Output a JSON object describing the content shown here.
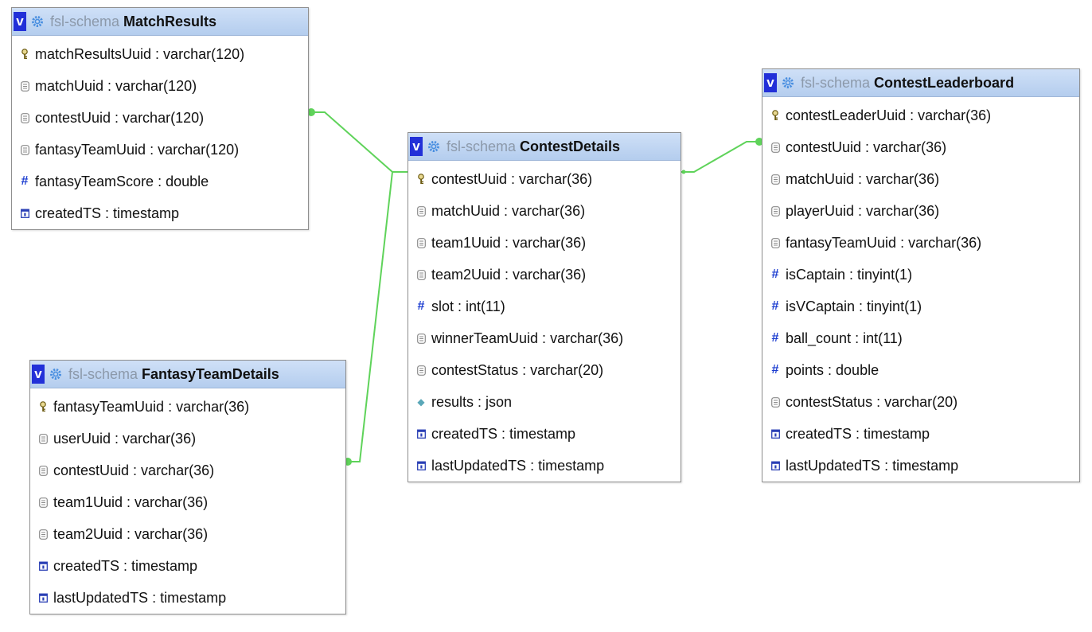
{
  "tables": [
    {
      "id": "match-results",
      "schema": "fsl-schema",
      "name": "MatchResults",
      "columns": [
        {
          "label": "matchResultsUuid : varchar(120)",
          "icon": "key-icon"
        },
        {
          "label": "matchUuid : varchar(120)",
          "icon": "text-column-icon"
        },
        {
          "label": "contestUuid : varchar(120)",
          "icon": "text-column-icon"
        },
        {
          "label": "fantasyTeamUuid : varchar(120)",
          "icon": "text-column-icon"
        },
        {
          "label": "fantasyTeamScore : double",
          "icon": "numeric-column-icon"
        },
        {
          "label": "createdTS : timestamp",
          "icon": "date-column-icon"
        }
      ]
    },
    {
      "id": "contest-details",
      "schema": "fsl-schema",
      "name": "ContestDetails",
      "columns": [
        {
          "label": "contestUuid : varchar(36)",
          "icon": "key-icon"
        },
        {
          "label": "matchUuid : varchar(36)",
          "icon": "text-column-icon"
        },
        {
          "label": "team1Uuid : varchar(36)",
          "icon": "text-column-icon"
        },
        {
          "label": "team2Uuid : varchar(36)",
          "icon": "text-column-icon"
        },
        {
          "label": "slot : int(11)",
          "icon": "numeric-column-icon"
        },
        {
          "label": "winnerTeamUuid : varchar(36)",
          "icon": "text-column-icon"
        },
        {
          "label": "contestStatus : varchar(20)",
          "icon": "text-column-icon"
        },
        {
          "label": "results : json",
          "icon": "json-column-icon"
        },
        {
          "label": "createdTS : timestamp",
          "icon": "date-column-icon"
        },
        {
          "label": "lastUpdatedTS : timestamp",
          "icon": "date-column-icon"
        }
      ]
    },
    {
      "id": "contest-leaderboard",
      "schema": "fsl-schema",
      "name": "ContestLeaderboard",
      "columns": [
        {
          "label": "contestLeaderUuid : varchar(36)",
          "icon": "key-icon"
        },
        {
          "label": "contestUuid : varchar(36)",
          "icon": "text-column-icon"
        },
        {
          "label": "matchUuid : varchar(36)",
          "icon": "text-column-icon"
        },
        {
          "label": "playerUuid : varchar(36)",
          "icon": "text-column-icon"
        },
        {
          "label": "fantasyTeamUuid : varchar(36)",
          "icon": "text-column-icon"
        },
        {
          "label": "isCaptain : tinyint(1)",
          "icon": "numeric-column-icon"
        },
        {
          "label": "isVCaptain : tinyint(1)",
          "icon": "numeric-column-icon"
        },
        {
          "label": "ball_count : int(11)",
          "icon": "numeric-column-icon"
        },
        {
          "label": "points : double",
          "icon": "numeric-column-icon"
        },
        {
          "label": "contestStatus : varchar(20)",
          "icon": "text-column-icon"
        },
        {
          "label": "createdTS : timestamp",
          "icon": "date-column-icon"
        },
        {
          "label": "lastUpdatedTS : timestamp",
          "icon": "date-column-icon"
        }
      ]
    },
    {
      "id": "fantasy-team-details",
      "schema": "fsl-schema",
      "name": "FantasyTeamDetails",
      "columns": [
        {
          "label": "fantasyTeamUuid : varchar(36)",
          "icon": "key-icon"
        },
        {
          "label": "userUuid : varchar(36)",
          "icon": "text-column-icon"
        },
        {
          "label": "contestUuid : varchar(36)",
          "icon": "text-column-icon"
        },
        {
          "label": "team1Uuid : varchar(36)",
          "icon": "text-column-icon"
        },
        {
          "label": "team2Uuid : varchar(36)",
          "icon": "text-column-icon"
        },
        {
          "label": "createdTS : timestamp",
          "icon": "date-column-icon"
        },
        {
          "label": "lastUpdatedTS : timestamp",
          "icon": "date-column-icon"
        }
      ]
    }
  ],
  "toggle_label": "v",
  "colors": {
    "relation_line": "#5fd35a",
    "header_top": "#cfe0f7",
    "header_bottom": "#b4cdee",
    "toggle_bg": "#2230d8",
    "schema_text": "#8c99aa"
  },
  "relations": [
    {
      "from": "match-results",
      "to": "contest-details"
    },
    {
      "from": "fantasy-team-details",
      "to": "contest-details"
    },
    {
      "from": "contest-details",
      "to": "contest-leaderboard"
    }
  ]
}
